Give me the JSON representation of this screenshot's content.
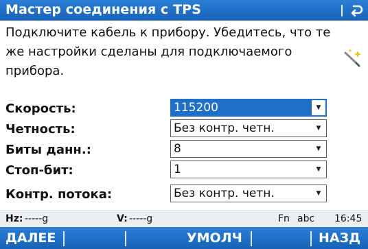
{
  "window": {
    "title": "Мастер соединения с TPS"
  },
  "message": "Подключите кабель к прибору. Убедитесь, что те же настройки сделаны для подключаемого прибора.",
  "form": {
    "rows": [
      {
        "label": "Скорость:",
        "value": "115200",
        "selected": true
      },
      {
        "label": "Четность:",
        "value": "Без контр. четн.",
        "selected": false
      },
      {
        "label": "Биты данн.:",
        "value": "8",
        "selected": false
      },
      {
        "label": "Стоп-бит:",
        "value": "1",
        "selected": false
      },
      {
        "label": "Контр. потока:",
        "value": "Без контр. четн.",
        "selected": false
      }
    ]
  },
  "status": {
    "hz_label": "Hz:",
    "hz_value": "-----g",
    "v_label": "V:",
    "v_value": "-----g",
    "fn": "Fn",
    "input_mode": "abc",
    "time": "16:45"
  },
  "softkeys": {
    "next": "ДАЛЕЕ",
    "default": "УМОЛЧ",
    "back": "НАЗД"
  },
  "colors": {
    "accent": "#1f6fc9",
    "statusbar": "#eceff2"
  },
  "icons": {
    "back": "back-arrow-icon",
    "wand": "magic-wand-icon",
    "dropdown": "chevron-down-icon"
  }
}
